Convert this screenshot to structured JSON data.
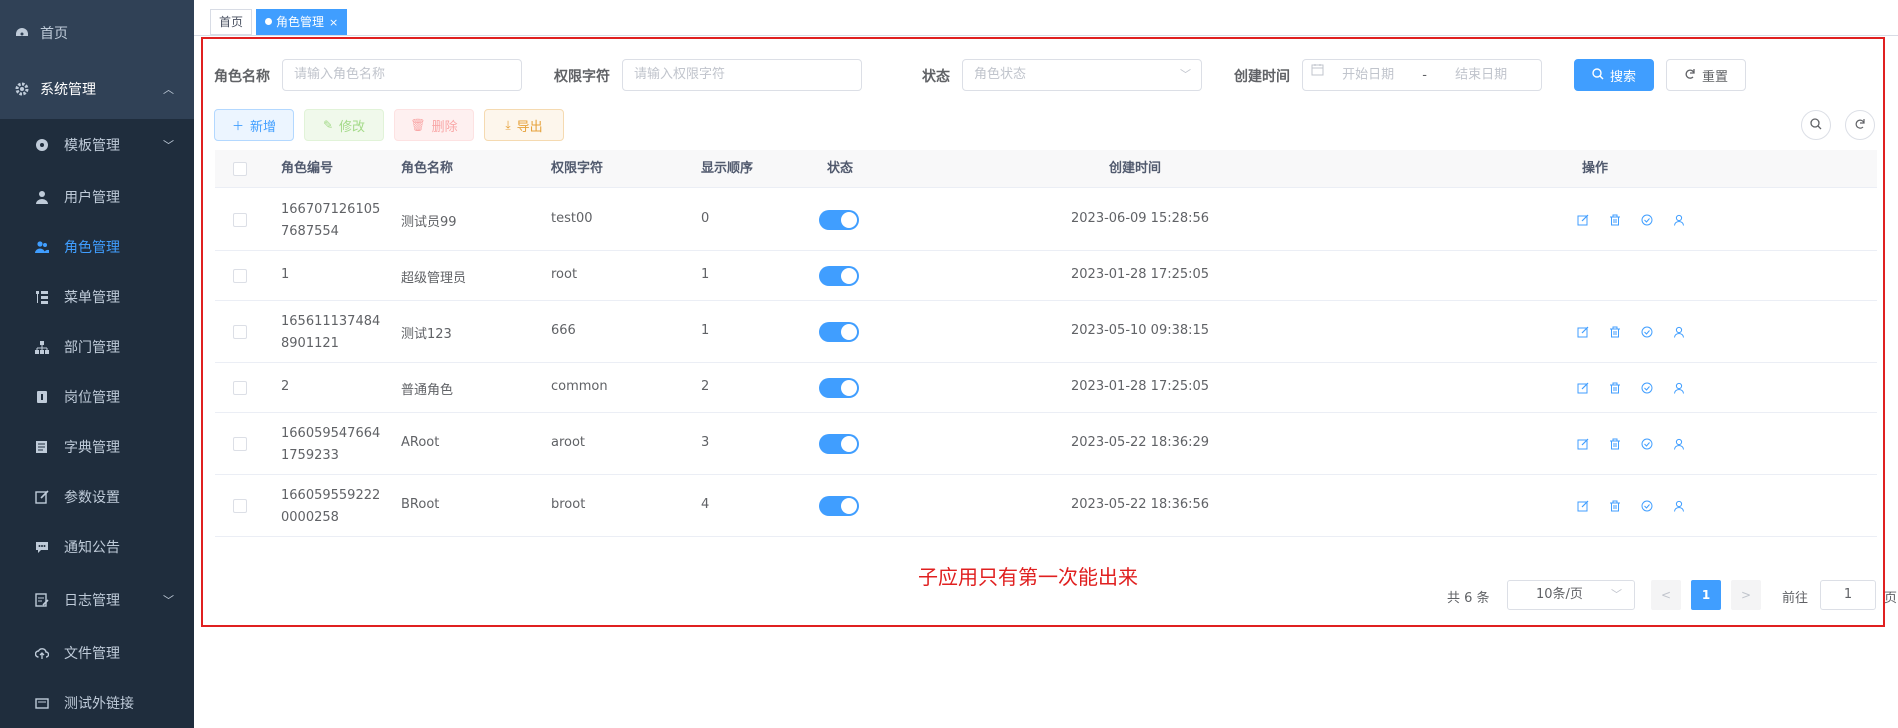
{
  "sidebar": {
    "items": [
      {
        "label": "首页",
        "icon": "dashboard-icon"
      },
      {
        "label": "系统管理",
        "icon": "gear-icon"
      },
      {
        "label": "模板管理",
        "icon": "template-icon"
      },
      {
        "label": "用户管理",
        "icon": "user-icon"
      },
      {
        "label": "角色管理",
        "icon": "peoples-icon"
      },
      {
        "label": "菜单管理",
        "icon": "tree-table-icon"
      },
      {
        "label": "部门管理",
        "icon": "tree-icon"
      },
      {
        "label": "岗位管理",
        "icon": "post-icon"
      },
      {
        "label": "字典管理",
        "icon": "dict-icon"
      },
      {
        "label": "参数设置",
        "icon": "edit-icon"
      },
      {
        "label": "通知公告",
        "icon": "message-icon"
      },
      {
        "label": "日志管理",
        "icon": "log-icon"
      },
      {
        "label": "文件管理",
        "icon": "upload-icon"
      },
      {
        "label": "测试外链接",
        "icon": "link-icon"
      }
    ]
  },
  "tags": [
    {
      "label": "首页"
    },
    {
      "label": "角色管理",
      "close": "×"
    }
  ],
  "search": {
    "role_name_label": "角色名称",
    "role_name_placeholder": "请输入角色名称",
    "role_key_label": "权限字符",
    "role_key_placeholder": "请输入权限字符",
    "status_label": "状态",
    "status_placeholder": "角色状态",
    "create_time_label": "创建时间",
    "start_placeholder": "开始日期",
    "range_separator": "-",
    "end_placeholder": "结束日期",
    "search_button": "搜索",
    "reset_button": "重置"
  },
  "toolbar": {
    "add": "新增",
    "edit": "修改",
    "delete": "删除",
    "export": "导出"
  },
  "table": {
    "headers": [
      "角色编号",
      "角色名称",
      "权限字符",
      "显示顺序",
      "状态",
      "创建时间",
      "操作"
    ],
    "rows": [
      {
        "id_line1": "166707126105",
        "id_line2": "7687554",
        "name": "测试员99",
        "key": "test00",
        "sort": "0",
        "status": true,
        "created": "2023-06-09 15:28:56",
        "ops": true
      },
      {
        "id_line1": "1",
        "id_line2": "",
        "name": "超级管理员",
        "key": "root",
        "sort": "1",
        "status": true,
        "created": "2023-01-28 17:25:05",
        "ops": false
      },
      {
        "id_line1": "165611137484",
        "id_line2": "8901121",
        "name": "测试123",
        "key": "666",
        "sort": "1",
        "status": true,
        "created": "2023-05-10 09:38:15",
        "ops": true
      },
      {
        "id_line1": "2",
        "id_line2": "",
        "name": "普通角色",
        "key": "common",
        "sort": "2",
        "status": true,
        "created": "2023-01-28 17:25:05",
        "ops": true
      },
      {
        "id_line1": "166059547664",
        "id_line2": "1759233",
        "name": "ARoot",
        "key": "aroot",
        "sort": "3",
        "status": true,
        "created": "2023-05-22 18:36:29",
        "ops": true
      },
      {
        "id_line1": "166059559222",
        "id_line2": "0000258",
        "name": "BRoot",
        "key": "broot",
        "sort": "4",
        "status": true,
        "created": "2023-05-22 18:36:56",
        "ops": true
      }
    ]
  },
  "annotation": "子应用只有第一次能出来",
  "pagination": {
    "total": "共 6 条",
    "page_size": "10条/页",
    "current": "1",
    "goto_label": "前往",
    "goto_value": "1",
    "page_suffix": "页"
  },
  "colors": {
    "sidebar_bg": "#304156",
    "submenu_bg": "#1f2d3d",
    "primary": "#409eff",
    "annotation": "#e02020"
  }
}
